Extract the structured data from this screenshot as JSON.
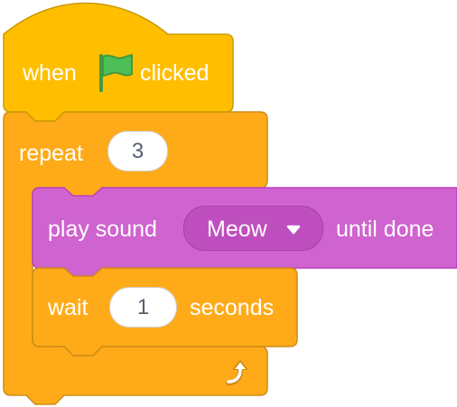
{
  "colors": {
    "events": "#ffbf00",
    "events_border": "#cc9900",
    "control": "#ffab19",
    "control_border": "#cf8b17",
    "sound": "#cf63cf",
    "sound_border": "#bd42bd",
    "sound_field": "#bf4fbf",
    "flag": "#4cbf56",
    "input_text": "#575e75"
  },
  "hat_block": {
    "label_before": "when",
    "icon": "green-flag-icon",
    "label_after": "clicked"
  },
  "repeat_block": {
    "label": "repeat",
    "count": "3",
    "loop_icon": "loop-arrow-icon"
  },
  "play_sound_block": {
    "label_before": "play sound",
    "sound": "Meow",
    "dropdown_icon": "caret-down-icon",
    "label_after": "until done"
  },
  "wait_block": {
    "label_before": "wait",
    "value": "1",
    "label_after": "seconds"
  }
}
